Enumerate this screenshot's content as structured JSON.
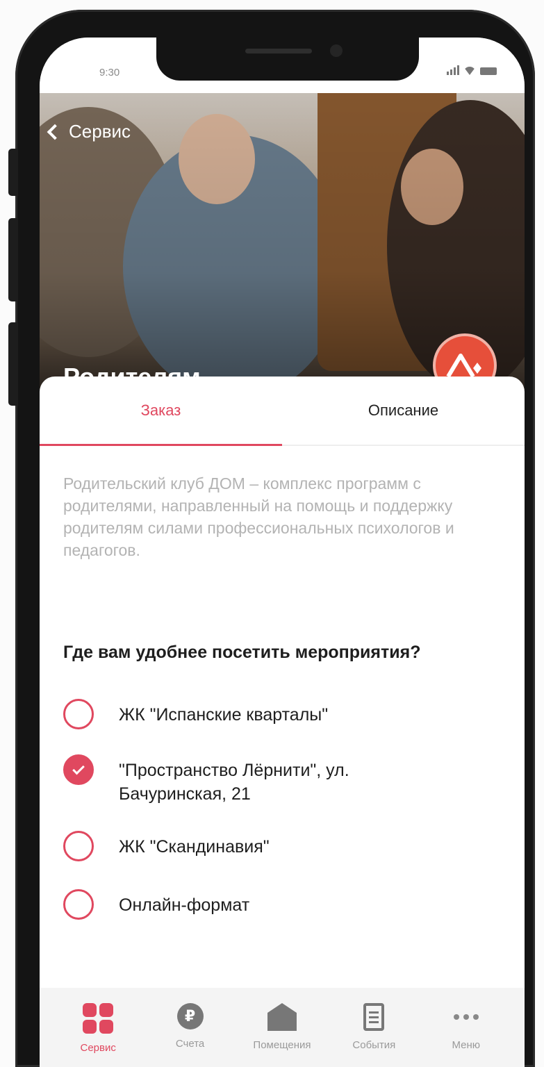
{
  "status_bar": {
    "time": "9:30"
  },
  "header": {
    "back_label": "Сервис",
    "title": "Родителям"
  },
  "tabs": [
    {
      "label": "Заказ",
      "active": true
    },
    {
      "label": "Описание",
      "active": false
    }
  ],
  "description": "Родительский клуб ДОМ – комплекс программ с родителями, направленный на помощь и поддержку родителям силами профессиональных психологов и педагогов.",
  "question": "Где вам удобнее посетить мероприятия?",
  "options": [
    {
      "label": "ЖК \"Испанские кварталы\"",
      "checked": false
    },
    {
      "label": "\"Пространство Лёрнити\", ул. Бачуринская, 21",
      "checked": true
    },
    {
      "label": "ЖК \"Скандинавия\"",
      "checked": false
    },
    {
      "label": "Онлайн-формат",
      "checked": false
    }
  ],
  "bottom_nav": [
    {
      "label": "Сервис",
      "icon": "services-grid-icon",
      "active": true
    },
    {
      "label": "Счета",
      "icon": "ruble-icon",
      "active": false
    },
    {
      "label": "Помещения",
      "icon": "house-icon",
      "active": false
    },
    {
      "label": "События",
      "icon": "document-icon",
      "active": false
    },
    {
      "label": "Меню",
      "icon": "more-dots-icon",
      "active": false
    }
  ],
  "colors": {
    "accent": "#e0485f",
    "brand_badge": "#e64f3a",
    "muted_text": "#b3b3b3"
  },
  "brand_badge_icon": "brand-logo-icon"
}
